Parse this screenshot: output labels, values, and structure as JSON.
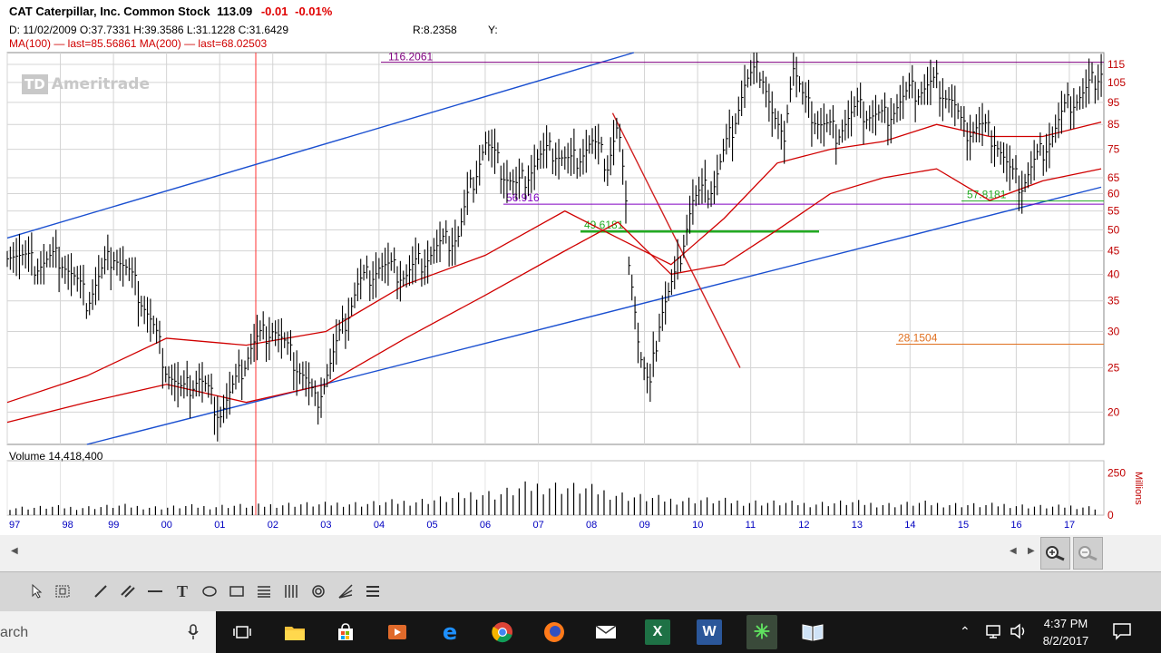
{
  "header": {
    "symbol": "CAT",
    "company": "Caterpillar, Inc. Common Stock",
    "last": "113.09",
    "change": "-0.01",
    "change_pct": "-0.01%",
    "ohlc": "D: 11/02/2009 O:37.7331 H:39.3586 L:31.1228 C:31.6429",
    "r_value": "R:8.2358",
    "y_label": "Y:",
    "ma_text": "MA(100) — last=85.56861 MA(200) — last=68.02503"
  },
  "watermark": {
    "logo_text": "TD",
    "brand": "Ameritrade"
  },
  "volume": {
    "label": "Volume 14,418,400",
    "axis_values": [
      "250",
      "0"
    ],
    "axis_unit": "Millions"
  },
  "chart_data": {
    "type": "line",
    "description_type": "price chart (OHLC bars, log scale) with moving averages and trendlines",
    "x_axis": {
      "labels": [
        "97",
        "98",
        "99",
        "00",
        "01",
        "02",
        "03",
        "04",
        "05",
        "06",
        "07",
        "08",
        "09",
        "10",
        "11",
        "12",
        "13",
        "14",
        "15",
        "16",
        "17"
      ]
    },
    "y_axis": {
      "scale": "log",
      "range": [
        17,
        122
      ],
      "tick_labels": [
        "115",
        "105",
        "95",
        "85",
        "75",
        "65",
        "60",
        "55",
        "50",
        "45",
        "40",
        "35",
        "30",
        "25",
        "20"
      ],
      "ticks": [
        115,
        105,
        95,
        85,
        75,
        65,
        60,
        55,
        50,
        45,
        40,
        35,
        30,
        25,
        20
      ]
    },
    "series": [
      {
        "type": "ohlc",
        "color": "#000000",
        "x": [
          1997.0,
          1997.5,
          1998.0,
          1998.5,
          1999.0,
          1999.3,
          1999.6,
          2000.0,
          2000.3,
          2000.6,
          2001.0,
          2001.3,
          2001.6,
          2002.0,
          2002.3,
          2002.6,
          2002.8,
          2003.0,
          2003.3,
          2003.6,
          2004.0,
          2004.5,
          2005.0,
          2005.5,
          2006.0,
          2006.3,
          2006.6,
          2007.0,
          2007.3,
          2007.6,
          2008.0,
          2008.3,
          2008.5,
          2008.7,
          2008.9,
          2009.1,
          2009.3,
          2009.6,
          2009.9,
          2010.3,
          2010.6,
          2010.9,
          2011.2,
          2011.4,
          2011.6,
          2011.8,
          2012.0,
          2012.3,
          2012.6,
          2013.0,
          2013.5,
          2014.0,
          2014.5,
          2014.8,
          2015.0,
          2015.3,
          2015.6,
          2015.9,
          2016.1,
          2016.4,
          2016.7,
          2017.0,
          2017.3,
          2017.6
        ],
        "close": [
          46,
          42,
          44,
          35,
          45,
          40,
          34,
          25,
          22,
          24,
          20,
          23,
          28,
          31,
          27,
          24,
          21,
          24,
          30,
          38,
          42,
          40,
          45,
          49,
          78,
          68,
          62,
          72,
          75,
          70,
          78,
          70,
          85,
          45,
          27,
          22,
          33,
          40,
          58,
          63,
          80,
          105,
          113,
          90,
          77,
          115,
          95,
          86,
          82,
          92,
          88,
          100,
          105,
          96,
          82,
          85,
          80,
          66,
          63,
          72,
          82,
          95,
          100,
          113
        ]
      },
      {
        "name": "MA(100)",
        "color": "#d00000",
        "x": [
          1997.0,
          1998.5,
          2000.0,
          2001.5,
          2003.0,
          2004.5,
          2006.0,
          2007.5,
          2008.5,
          2009.5,
          2010.5,
          2011.5,
          2012.5,
          2013.5,
          2014.5,
          2015.5,
          2016.5,
          2017.6
        ],
        "values": [
          21,
          24,
          29,
          28,
          30,
          38,
          44,
          55,
          48,
          42,
          53,
          70,
          75,
          78,
          85,
          80,
          80,
          86
        ]
      },
      {
        "name": "MA(200)",
        "color": "#d00000",
        "x": [
          1997.0,
          1998.5,
          2000.0,
          2001.5,
          2003.0,
          2004.5,
          2006.0,
          2007.5,
          2008.5,
          2009.5,
          2010.5,
          2011.5,
          2012.5,
          2013.5,
          2014.5,
          2015.5,
          2016.5,
          2017.6
        ],
        "values": [
          19,
          21,
          23,
          21,
          23,
          29,
          36,
          45,
          52,
          40,
          42,
          50,
          60,
          65,
          68,
          58,
          64,
          68
        ]
      }
    ],
    "annotations": [
      {
        "label": "116.2061",
        "value": 116.2061,
        "color": "#800080"
      },
      {
        "label": "56.916",
        "value": 56.916,
        "color": "#8000c0"
      },
      {
        "label": "57.8181",
        "value": 57.8181,
        "color": "#22aa22"
      },
      {
        "label": "49.6181",
        "value": 49.6181,
        "color": "#22aa22"
      },
      {
        "label": "28.1504",
        "value": 28.1504,
        "color": "#e07020"
      }
    ],
    "trendlines": [
      {
        "color": "#1a4fd0",
        "from": [
          1997.0,
          48
        ],
        "to": [
          2008.8,
          122
        ]
      },
      {
        "color": "#1a4fd0",
        "from": [
          1998.5,
          17
        ],
        "to": [
          2017.6,
          62
        ]
      },
      {
        "color": "#d02020",
        "from": [
          2008.4,
          90
        ],
        "to": [
          2010.8,
          25
        ]
      }
    ],
    "volume_values": [
      20,
      20,
      22,
      20,
      22,
      25,
      22,
      20,
      24,
      22,
      26,
      24,
      28,
      30,
      28,
      32,
      30,
      34,
      36,
      40,
      45,
      60,
      55,
      70,
      80,
      75,
      70,
      60,
      50,
      45,
      40,
      42,
      38,
      36,
      34,
      32,
      30,
      32,
      34,
      30,
      28,
      32,
      30,
      28,
      26,
      28,
      24,
      22,
      24,
      20
    ],
    "volume_ylim": [
      0,
      300
    ],
    "grid": true,
    "colors": {
      "price": "#000000",
      "ma": "#d00000",
      "trend": "#1a4fd0",
      "axis_text": "#0000c0"
    }
  },
  "toolbar": {
    "tools": [
      "pointer-tool",
      "zoom-box-tool",
      "pencil-tool",
      "parallel-line-tool",
      "horizontal-line-tool",
      "text-tool",
      "ellipse-tool",
      "rectangle-tool",
      "fibonacci-tool",
      "vertical-lines-tool",
      "gann-fan-tool",
      "speed-lines-tool",
      "menu-tool"
    ]
  },
  "taskbar": {
    "search_text": "arch",
    "time": "4:37 PM",
    "date": "8/2/2017"
  }
}
